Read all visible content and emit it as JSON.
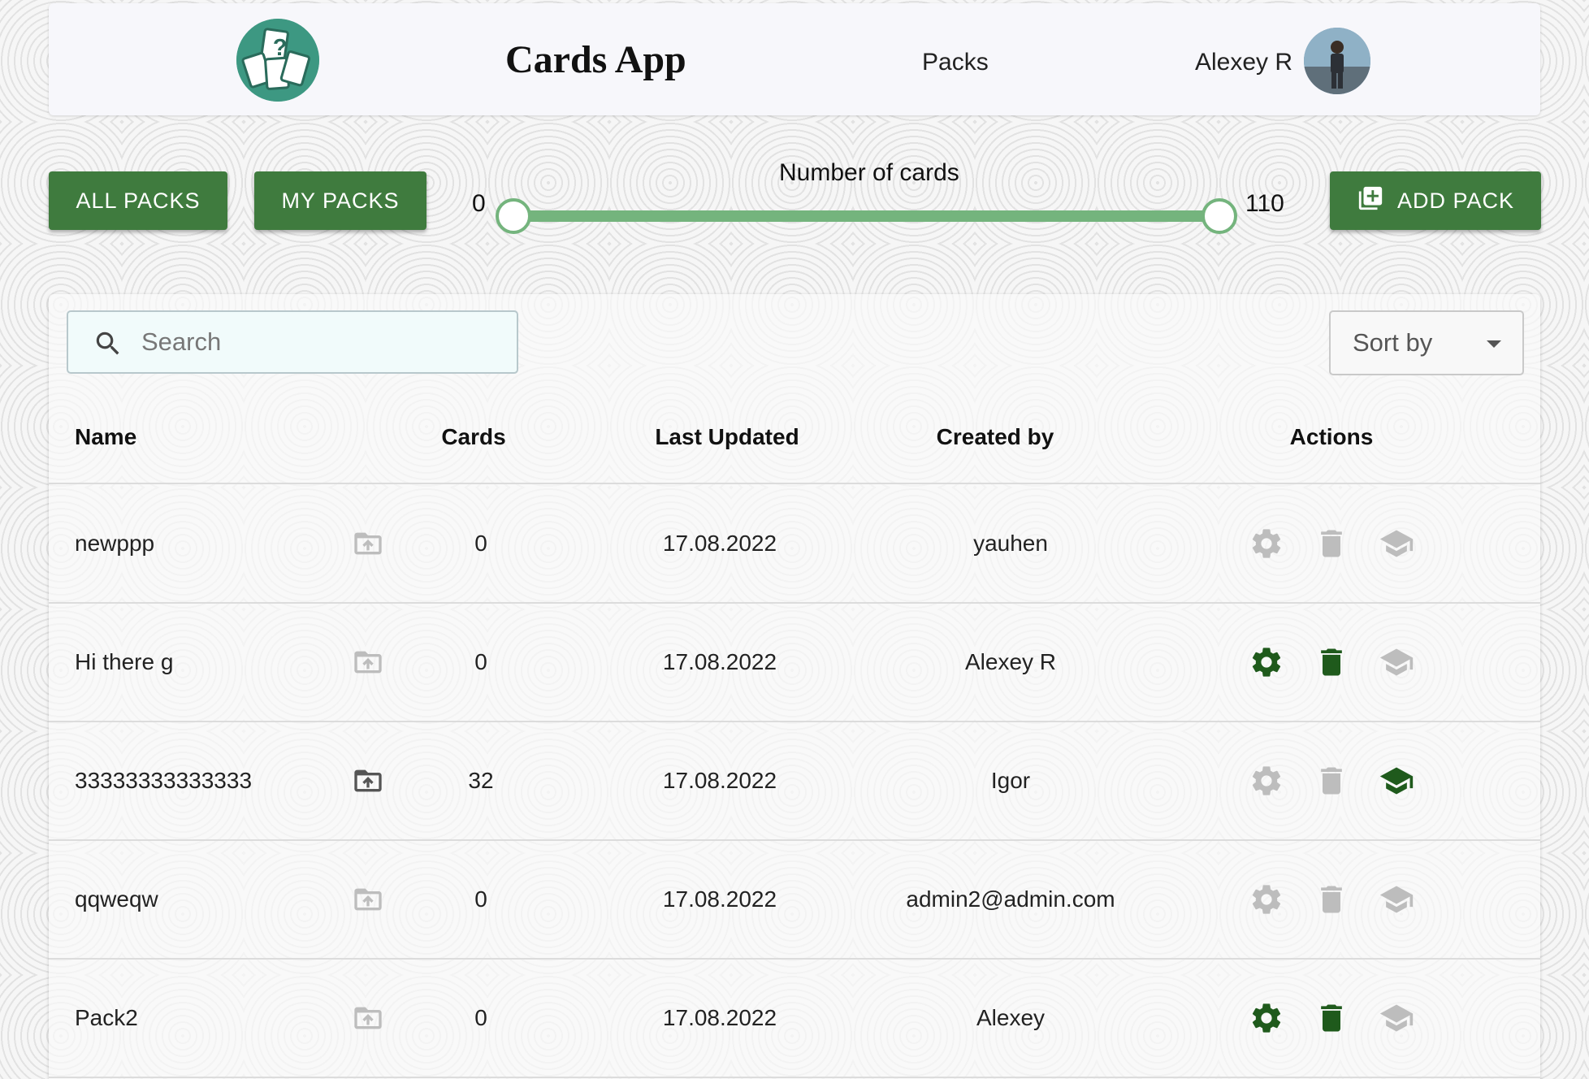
{
  "header": {
    "title": "Cards App",
    "nav_packs": "Packs",
    "user_name": "Alexey R",
    "logo_icon": "cards-logo-icon",
    "avatar_icon": "user-avatar"
  },
  "controls": {
    "all_packs": "ALL PACKS",
    "my_packs": "MY PACKS",
    "add_pack": "ADD PACK",
    "slider": {
      "label": "Number of cards",
      "min": "0",
      "max": "110",
      "value_min": 0,
      "value_max": 110
    }
  },
  "search": {
    "placeholder": "Search",
    "value": ""
  },
  "sort": {
    "label": "Sort by"
  },
  "table": {
    "headers": {
      "name": "Name",
      "cards": "Cards",
      "last_updated": "Last Updated",
      "created_by": "Created by",
      "actions": "Actions"
    },
    "rows": [
      {
        "name": "newppp",
        "cards": "0",
        "updated": "17.08.2022",
        "created_by": "yauhen",
        "folder_active": false,
        "edit_active": false,
        "delete_active": false,
        "learn_active": false
      },
      {
        "name": "Hi there g",
        "cards": "0",
        "updated": "17.08.2022",
        "created_by": "Alexey R",
        "folder_active": false,
        "edit_active": true,
        "delete_active": true,
        "learn_active": false
      },
      {
        "name": "33333333333333",
        "cards": "32",
        "updated": "17.08.2022",
        "created_by": "Igor",
        "folder_active": true,
        "edit_active": false,
        "delete_active": false,
        "learn_active": true
      },
      {
        "name": "qqweqw",
        "cards": "0",
        "updated": "17.08.2022",
        "created_by": "admin2@admin.com",
        "folder_active": false,
        "edit_active": false,
        "delete_active": false,
        "learn_active": false
      },
      {
        "name": "Pack2",
        "cards": "0",
        "updated": "17.08.2022",
        "created_by": "Alexey",
        "folder_active": false,
        "edit_active": true,
        "delete_active": true,
        "learn_active": false
      }
    ]
  },
  "colors": {
    "primary_green": "#3f7b3e",
    "active_icon": "#1f5a1c",
    "inactive_icon": "#bdbdbd",
    "slider": "#74b47d",
    "logo_bg": "#3d9882"
  }
}
